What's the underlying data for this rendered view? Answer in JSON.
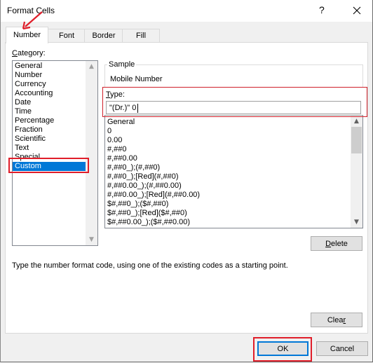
{
  "window": {
    "title": "Format Cells",
    "help_label": "?",
    "close_icon": "close-icon"
  },
  "tabs": [
    {
      "label": "Number",
      "active": true
    },
    {
      "label": "Font",
      "active": false
    },
    {
      "label": "Border",
      "active": false
    },
    {
      "label": "Fill",
      "active": false
    }
  ],
  "category": {
    "label_prefix": "C",
    "label_rest": "ategory:",
    "items": [
      "General",
      "Number",
      "Currency",
      "Accounting",
      "Date",
      "Time",
      "Percentage",
      "Fraction",
      "Scientific",
      "Text",
      "Special",
      "Custom"
    ],
    "selected": "Custom"
  },
  "sample": {
    "label": "Sample",
    "value": "Mobile Number"
  },
  "type": {
    "label_prefix": "T",
    "label_rest": "ype:",
    "value": "\"(Dr.)\" 0"
  },
  "formats": [
    "General",
    "0",
    "0.00",
    "#,##0",
    "#,##0.00",
    "#,##0_);(#,##0)",
    "#,##0_);[Red](#,##0)",
    "#,##0.00_);(#,##0.00)",
    "#,##0.00_);[Red](#,##0.00)",
    "$#,##0_);($#,##0)",
    "$#,##0_);[Red]($#,##0)",
    "$#,##0.00_);($#,##0.00)"
  ],
  "buttons": {
    "delete_prefix": "D",
    "delete_rest": "elete",
    "clear_prefix": "Clea",
    "clear_accel": "r",
    "ok": "OK",
    "cancel": "Cancel"
  },
  "hint": "Type the number format code, using one of the existing codes as a starting point.",
  "annotations": {
    "highlight_color": "#e01e2a",
    "selection_color": "#0078d7"
  }
}
